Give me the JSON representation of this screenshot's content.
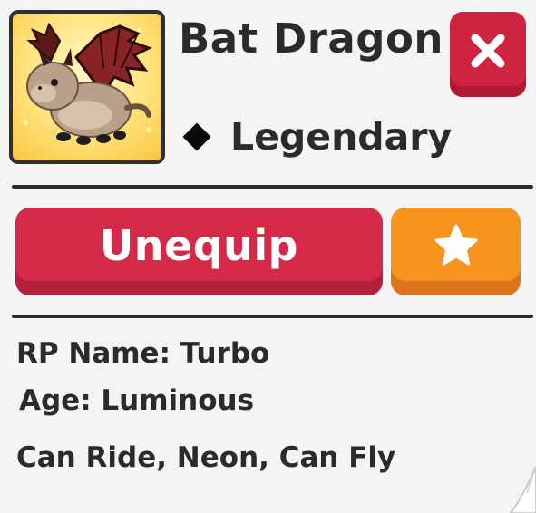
{
  "pet": {
    "name": "Bat Dragon",
    "rarity": "Legendary"
  },
  "actions": {
    "unequip_label": "Unequip"
  },
  "info": {
    "rp_name": "RP Name: Turbo",
    "age": "Age: Luminous",
    "flags": "Can Ride, Neon, Can Fly"
  },
  "icons": {
    "close": "close-x-icon",
    "favorite": "star-icon",
    "rarity": "diamond-icon"
  },
  "colors": {
    "close_button": "#cf2440",
    "unequip_button": "#d42a47",
    "favorite_button": "#f7941f",
    "portrait_background": "#ffe27a",
    "text": "#2b2b2b"
  }
}
